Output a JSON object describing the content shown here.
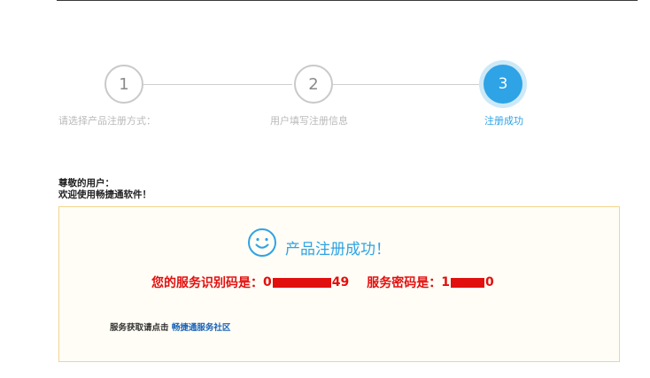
{
  "steps": [
    {
      "number": "1",
      "label": "请选择产品注册方式：",
      "state": "done"
    },
    {
      "number": "2",
      "label": "用户填写注册信息",
      "state": "done"
    },
    {
      "number": "3",
      "label": "注册成功",
      "state": "active"
    }
  ],
  "greeting": {
    "line1": "尊敬的用户：",
    "line2": "欢迎使用畅捷通软件！"
  },
  "result": {
    "icon": "smile-icon",
    "title": "产品注册成功！",
    "service_id_label": "您的服务识别码是：",
    "service_id_prefix": "0",
    "service_id_suffix": "49",
    "password_label": "服务密码是：",
    "password_prefix": "1",
    "password_suffix": "0",
    "footer_text": "服务获取请点击",
    "footer_link": "畅捷通服务社区"
  },
  "colors": {
    "accent": "#2ea3e6",
    "alert_red": "#e20f0f",
    "panel_border": "#f3d48c",
    "link": "#1a63b8"
  }
}
